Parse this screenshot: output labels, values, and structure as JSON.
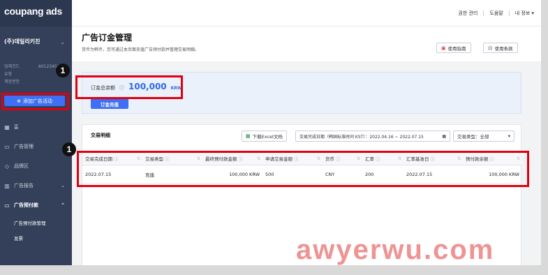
{
  "sidebar": {
    "brand": "coupang ads",
    "account_name": "(주)데일리키친",
    "account_chevron": "⌄",
    "meta": [
      {
        "label": "업체코드",
        "value": "A0123456789"
      },
      {
        "label": "유형",
        "value": "-"
      },
      {
        "label": "계정권한",
        "value": ""
      }
    ],
    "add_button": "添加广告活动",
    "items": [
      {
        "icon": "▦",
        "label": "홈"
      },
      {
        "icon": "▭",
        "label": "广告管理"
      },
      {
        "icon": "◇",
        "label": "品牌区"
      },
      {
        "icon": "▥",
        "label": "广告报告",
        "chevron": "⌄"
      },
      {
        "icon": "▭",
        "label": "广告预付款",
        "chevron": "⌃"
      }
    ],
    "sub_items": [
      "广告预付款管理",
      "发票"
    ]
  },
  "topbar": {
    "items": [
      "권한 관리",
      "도움말",
      "내 정보 ▾"
    ]
  },
  "page": {
    "title": "广告订金管理",
    "desc": "货币为韩币，您可通过本页面充值广告预付款并管理交易明细。",
    "guide_btn": "使用指南",
    "terms_btn": "使用条款"
  },
  "balance": {
    "label": "订金总余额",
    "q": "ⓘ",
    "value": "100,000",
    "currency": "KRW",
    "charge_btn": "订金充值"
  },
  "transactions": {
    "title": "交易明细",
    "excel_btn": "下载Excel文档",
    "date_range": "交易完成日期（韩国标准时间 KST）：2022.04.16 ~ 2022.07.15",
    "type_select": "交易类型：全部",
    "columns": [
      "交易完成日期",
      "交易类型",
      "最终预付款金额",
      "申请交易金额",
      "货币",
      "汇率",
      "汇率基准日",
      "预付款余额"
    ],
    "rows": [
      [
        "2022.07.15",
        "充值",
        "100,000 KRW",
        "500",
        "CNY",
        "200",
        "2022.07.15",
        "100,000 KRW"
      ]
    ]
  },
  "annotations": {
    "badge1": "1",
    "badge2": "1"
  },
  "watermark": "awyerwu.com",
  "colors": {
    "sidebar": "#34405a",
    "accent": "#3e6ff4",
    "annotation_red": "#e00010"
  }
}
